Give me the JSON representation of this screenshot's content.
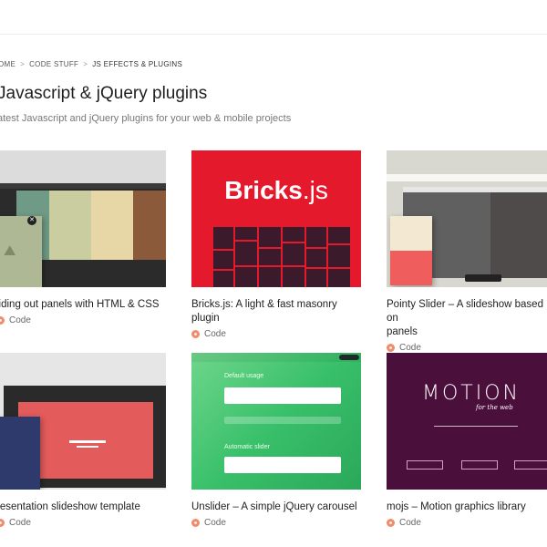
{
  "breadcrumb": {
    "home": "OME",
    "code_stuff": "CODE STUFF",
    "current": "JS EFFECTS & PLUGINS",
    "separator": ">"
  },
  "page": {
    "title": "Javascript & jQuery plugins",
    "subtitle": "atest Javascript and jQuery plugins for your web & mobile projects"
  },
  "cards": [
    {
      "title": "liding out panels with HTML & CSS",
      "category": "Code"
    },
    {
      "title": "Bricks.js: A light & fast masonry plugin",
      "category": "Code",
      "logo_main": "Bricks",
      "logo_ext": ".js"
    },
    {
      "title": "Pointy Slider – A slideshow based on",
      "title2": "panels",
      "category": "Code"
    },
    {
      "title": "resentation slideshow template",
      "category": "Code"
    },
    {
      "title": "Unslider – A simple jQuery carousel",
      "category": "Code",
      "label1": "Default usage",
      "label2": "Automatic slider"
    },
    {
      "title": "mojs – Motion graphics library",
      "category": "Code",
      "logo": "MOTION",
      "tagline": "for the web"
    }
  ],
  "colors": {
    "bricks_red": "#e41a2c",
    "mojs_purple": "#4b0f3b",
    "unslider_green": "#39c06a",
    "category_dot": "#f08b6b"
  }
}
